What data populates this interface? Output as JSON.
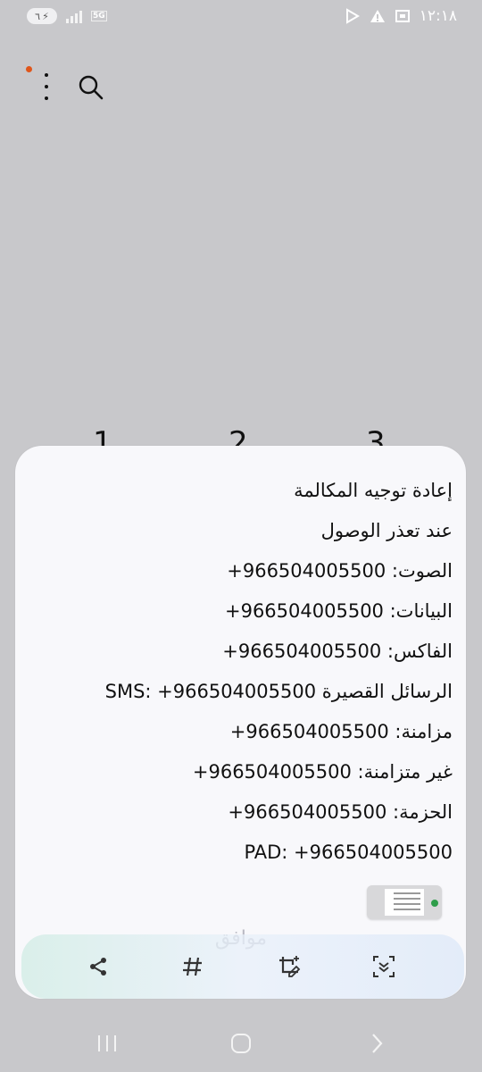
{
  "status_bar": {
    "battery": "٦",
    "network": "5G",
    "time": "١٢:١٨"
  },
  "dialer_peek": {
    "digits": [
      "1",
      "2",
      "3"
    ]
  },
  "dialog": {
    "lines": [
      "إعادة توجيه المكالمة",
      "عند تعذر الوصول",
      "الصوت: ‎+966504005500",
      "البيانات: ‎+966504005500",
      "الفاكس: ‎+966504005500",
      "الرسائل القصيرة ‎SMS: +966504005500",
      "مزامنة: ‎+966504005500",
      "غير متزامنة: ‎+966504005500",
      "الحزمة: ‎+966504005500",
      "PAD: +966504005500"
    ],
    "ok_label": "موافق"
  },
  "screenshot_toolbar": {
    "share": "share-icon",
    "hashtag": "hashtag-icon",
    "edit": "crop-edit-icon",
    "scroll_capture": "scroll-capture-icon"
  },
  "colors": {
    "background": "#c8c8cb",
    "dialog": "#f8f8fb",
    "notification_dot": "#e0561b"
  }
}
